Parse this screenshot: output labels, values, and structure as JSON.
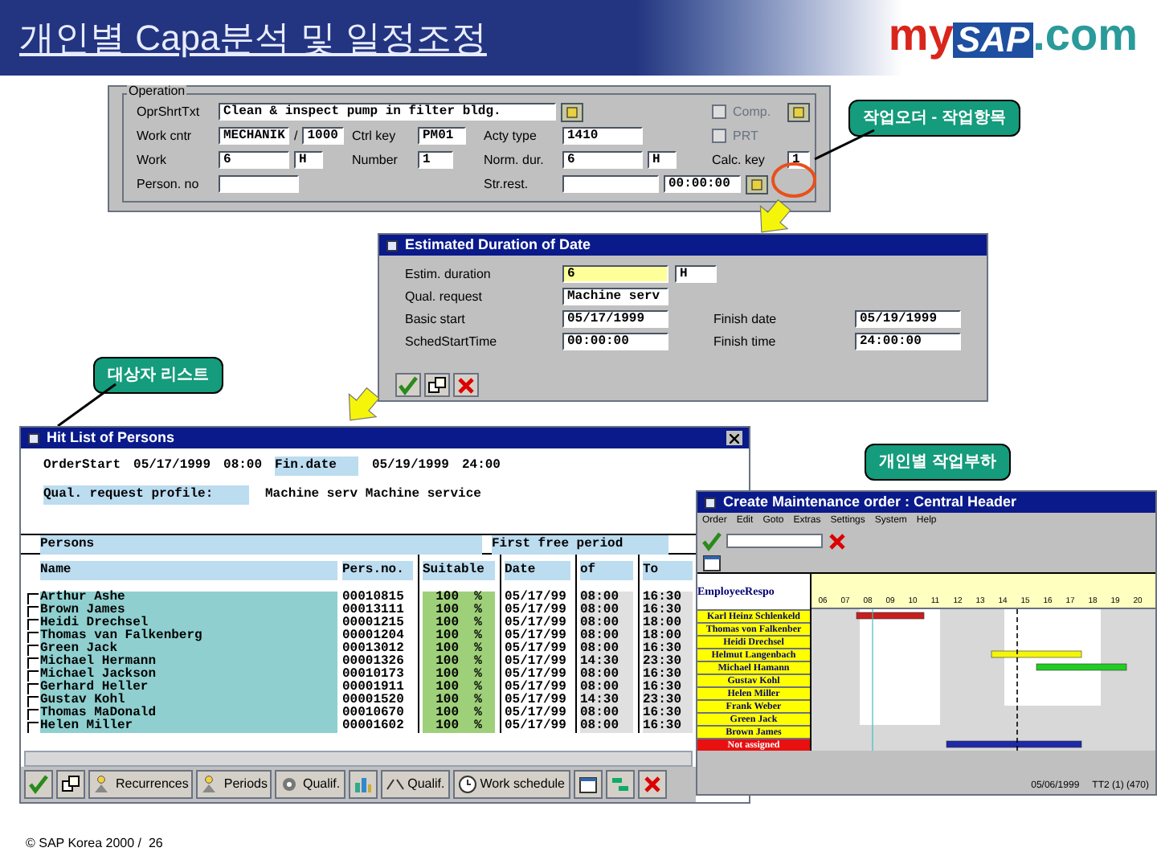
{
  "slide": {
    "title": "개인별 Capa분석 및 일정조정",
    "logo": [
      "my",
      "SAP",
      ".com"
    ],
    "footer": "© SAP Korea 2000 /  26"
  },
  "operation": {
    "group": "Operation",
    "fields": [
      {
        "label": "OprShrtTxt",
        "parts": [
          {
            "kind": "input",
            "value": "Clean & inspect pump in filter bldg."
          },
          {
            "kind": "button"
          }
        ]
      },
      {
        "label": "Work cntr",
        "parts": [
          {
            "kind": "input",
            "value": "MECHANIK"
          },
          {
            "kind": "text",
            "value": "/"
          },
          {
            "kind": "input",
            "value": "1000"
          }
        ]
      },
      {
        "label": "Ctrl key",
        "parts": [
          {
            "kind": "input",
            "value": "PM01"
          }
        ]
      },
      {
        "label": "Acty type",
        "parts": [
          {
            "kind": "input",
            "value": "1410"
          }
        ]
      },
      {
        "label": "Work",
        "parts": [
          {
            "kind": "input",
            "value": "6"
          },
          {
            "kind": "input",
            "value": "H"
          }
        ]
      },
      {
        "label": "Number",
        "parts": [
          {
            "kind": "input",
            "value": "1"
          }
        ]
      },
      {
        "label": "Norm. dur.",
        "parts": [
          {
            "kind": "input",
            "value": "6"
          },
          {
            "kind": "input",
            "value": "H"
          }
        ]
      },
      {
        "label": "Calc. key",
        "parts": [
          {
            "kind": "input",
            "value": "1"
          }
        ]
      },
      {
        "label": "Person. no",
        "parts": [
          {
            "kind": "input"
          }
        ]
      },
      {
        "label": "Str.rest.",
        "parts": [
          {
            "kind": "input"
          },
          {
            "kind": "input",
            "value": "00:00:00"
          },
          {
            "kind": "button"
          }
        ]
      }
    ],
    "checks": [
      {
        "label": "Comp.",
        "checked": false
      },
      {
        "label": "PRT",
        "checked": false
      }
    ]
  },
  "callouts": [
    {
      "text": "작업오더 - 작업항목"
    },
    {
      "text": "대상자 리스트"
    },
    {
      "text": "개인별 작업부하"
    }
  ],
  "dialog": {
    "title": "Estimated Duration of Date",
    "fields": [
      {
        "label": "Estim. duration",
        "value": "6",
        "unit": "H",
        "highlight": true
      },
      {
        "label": "Qual. request",
        "value": "Machine serv",
        "highlight": false
      },
      {
        "label": "Basic start",
        "value": "05/17/1999",
        "label2": "Finish date",
        "value2": "05/19/1999",
        "highlight": false
      },
      {
        "label": "SchedStartTime",
        "value": "00:00:00",
        "label2": "Finish time",
        "value2": "24:00:00",
        "highlight": false
      }
    ]
  },
  "hitlist": {
    "title": "Hit List of Persons",
    "header": [
      {
        "text": "OrderStart",
        "shaded": false
      },
      {
        "text": "05/17/1999",
        "shaded": false
      },
      {
        "text": "08:00",
        "shaded": false
      },
      {
        "text": "Fin.date",
        "shaded": true
      },
      {
        "text": "05/19/1999",
        "shaded": false
      },
      {
        "text": "24:00",
        "shaded": false
      }
    ],
    "profile_label": "Qual. request profile:",
    "profile_value": "Machine serv Machine service",
    "groups": [
      "Persons",
      "First free period"
    ],
    "columns": [
      "Name",
      "Pers.no.",
      "Suitable",
      "Date",
      "of",
      "To"
    ],
    "rows": [
      {
        "checked": false,
        "cells": [
          "Arthur Ashe",
          "00010815",
          "100  %",
          "05/17/99",
          "08:00",
          "16:30"
        ]
      },
      {
        "checked": false,
        "cells": [
          "Brown James",
          "00013111",
          "100  %",
          "05/17/99",
          "08:00",
          "16:30"
        ]
      },
      {
        "checked": false,
        "cells": [
          "Heidi Drechsel",
          "00001215",
          "100  %",
          "05/17/99",
          "08:00",
          "18:00"
        ]
      },
      {
        "checked": false,
        "cells": [
          "Thomas van Falkenberg",
          "00001204",
          "100  %",
          "05/17/99",
          "08:00",
          "18:00"
        ]
      },
      {
        "checked": false,
        "cells": [
          "Green Jack",
          "00013012",
          "100  %",
          "05/17/99",
          "08:00",
          "16:30"
        ]
      },
      {
        "checked": false,
        "cells": [
          "Michael Hermann",
          "00001326",
          "100  %",
          "05/17/99",
          "14:30",
          "23:30"
        ]
      },
      {
        "checked": false,
        "cells": [
          "Michael Jackson",
          "00010173",
          "100  %",
          "05/17/99",
          "08:00",
          "16:30"
        ]
      },
      {
        "checked": false,
        "cells": [
          "Gerhard Heller",
          "00001911",
          "100  %",
          "05/17/99",
          "08:00",
          "16:30"
        ]
      },
      {
        "checked": false,
        "cells": [
          "Gustav Kohl",
          "00001520",
          "100  %",
          "05/17/99",
          "14:30",
          "23:30"
        ]
      },
      {
        "checked": false,
        "cells": [
          "Thomas MaDonald",
          "00010670",
          "100  %",
          "05/17/99",
          "08:00",
          "16:30"
        ]
      },
      {
        "checked": false,
        "cells": [
          "Helen Miller",
          "00001602",
          "100  %",
          "05/17/99",
          "08:00",
          "16:30"
        ]
      }
    ],
    "toolbar": [
      {
        "kind": "ok"
      },
      {
        "kind": "copy"
      },
      {
        "kind": "person",
        "label": "Recurrences"
      },
      {
        "kind": "person",
        "label": "Periods"
      },
      {
        "kind": "gear",
        "label": "Qualif."
      },
      {
        "kind": "bars"
      },
      {
        "kind": "compare",
        "label": "Qualif."
      },
      {
        "kind": "clock",
        "label": "Work schedule"
      },
      {
        "kind": "calendar"
      },
      {
        "kind": "gantt"
      },
      {
        "kind": "cancel"
      }
    ]
  },
  "gantt": {
    "title": "Create Maintenance order : Central Header",
    "menu": [
      "Order",
      "Edit",
      "Goto",
      "Extras",
      "Settings",
      "System",
      "Help"
    ],
    "column_head": "EmployeeRespo",
    "hours": [
      "06",
      "07",
      "08",
      "09",
      "10",
      "11",
      "12",
      "13",
      "14",
      "15",
      "16",
      "17",
      "18",
      "19",
      "20"
    ],
    "employees": [
      {
        "name": "Karl Heinz Schlenkeld",
        "assigned": true
      },
      {
        "name": "Thomas von Falkenber",
        "assigned": true
      },
      {
        "name": "Heidi Drechsel",
        "assigned": true
      },
      {
        "name": "Helmut Langenbach",
        "assigned": true
      },
      {
        "name": "Michael Hamann",
        "assigned": true
      },
      {
        "name": "Gustav Kohl",
        "assigned": true
      },
      {
        "name": "Helen Miller",
        "assigned": true
      },
      {
        "name": "Frank Weber",
        "assigned": true
      },
      {
        "name": "Green Jack",
        "assigned": true
      },
      {
        "name": "Brown James",
        "assigned": true
      },
      {
        "name": "Not assigned",
        "assigned": false
      }
    ],
    "status": [
      "05/06/1999",
      "TT2 (1) (470)"
    ]
  }
}
